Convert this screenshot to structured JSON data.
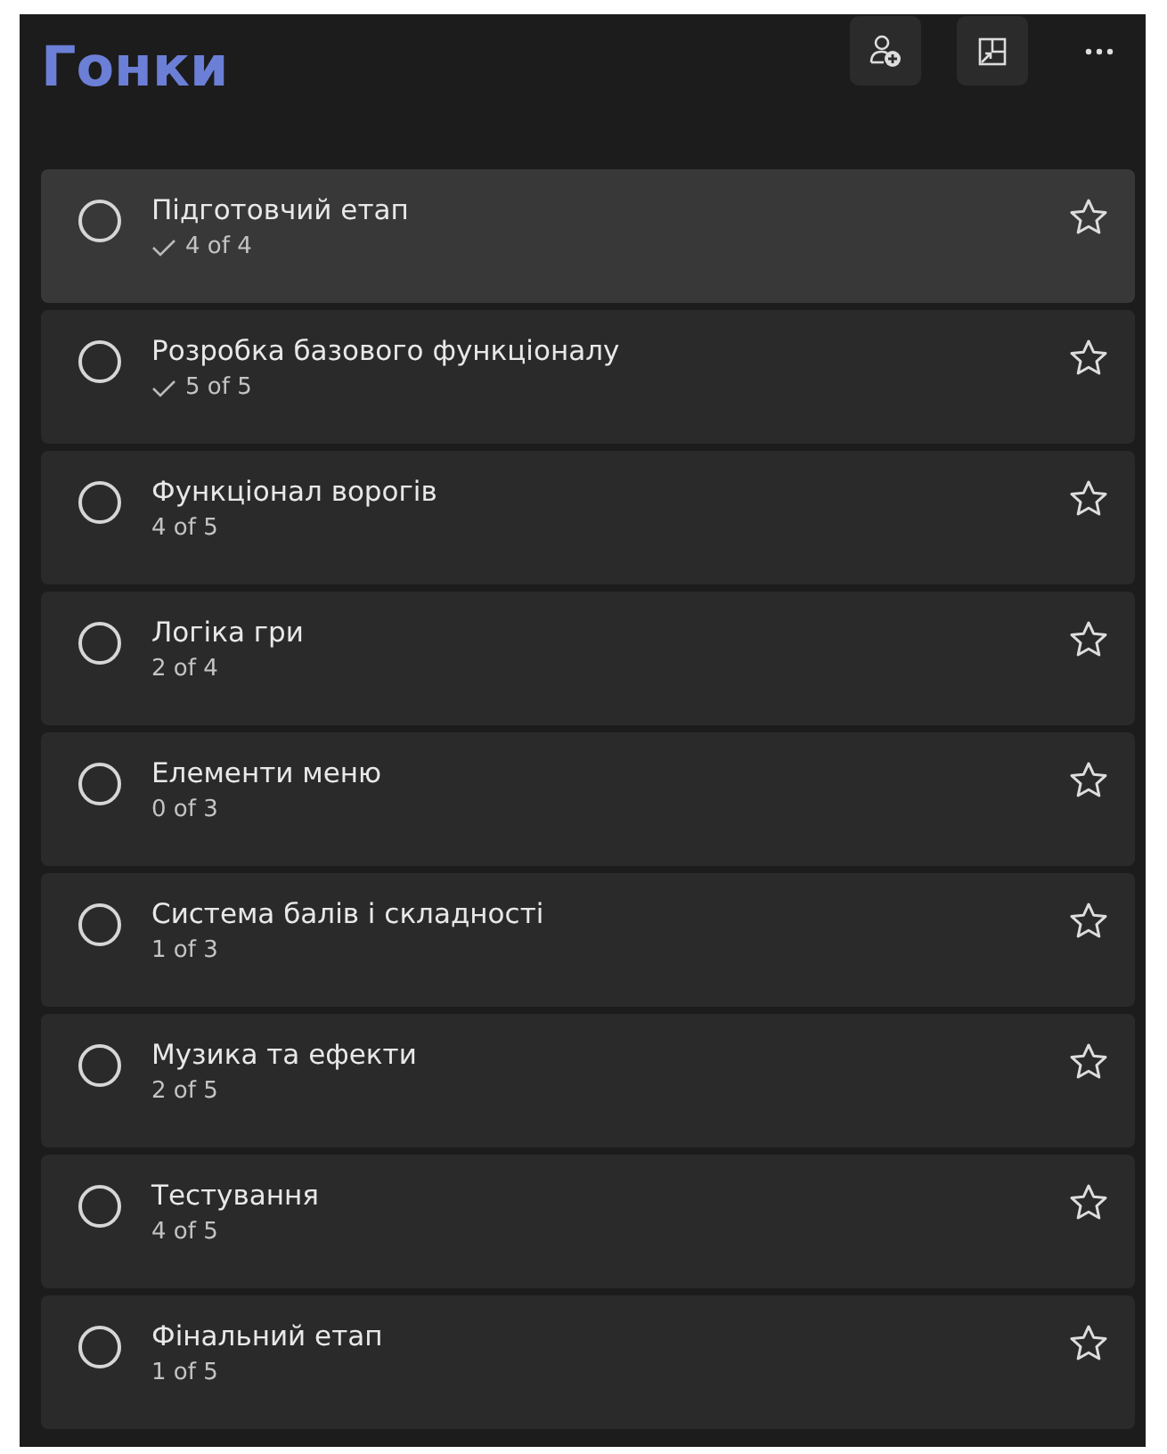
{
  "list_title": "Гонки",
  "tasks": [
    {
      "title": "Підготовчий етап",
      "progress": "4 of 4",
      "all_done": true,
      "selected": true
    },
    {
      "title": "Розробка базового функціоналу",
      "progress": "5 of 5",
      "all_done": true,
      "selected": false
    },
    {
      "title": "Функціонал ворогів",
      "progress": "4 of 5",
      "all_done": false,
      "selected": false
    },
    {
      "title": "Логіка гри",
      "progress": "2 of 4",
      "all_done": false,
      "selected": false
    },
    {
      "title": "Елементи меню",
      "progress": "0 of 3",
      "all_done": false,
      "selected": false
    },
    {
      "title": "Система балів і складності",
      "progress": "1 of 3",
      "all_done": false,
      "selected": false
    },
    {
      "title": "Музика та ефекти",
      "progress": "2 of 5",
      "all_done": false,
      "selected": false
    },
    {
      "title": "Тестування",
      "progress": "4 of 5",
      "all_done": false,
      "selected": false
    },
    {
      "title": "Фінальний етап",
      "progress": "1 of 5",
      "all_done": false,
      "selected": false
    }
  ]
}
